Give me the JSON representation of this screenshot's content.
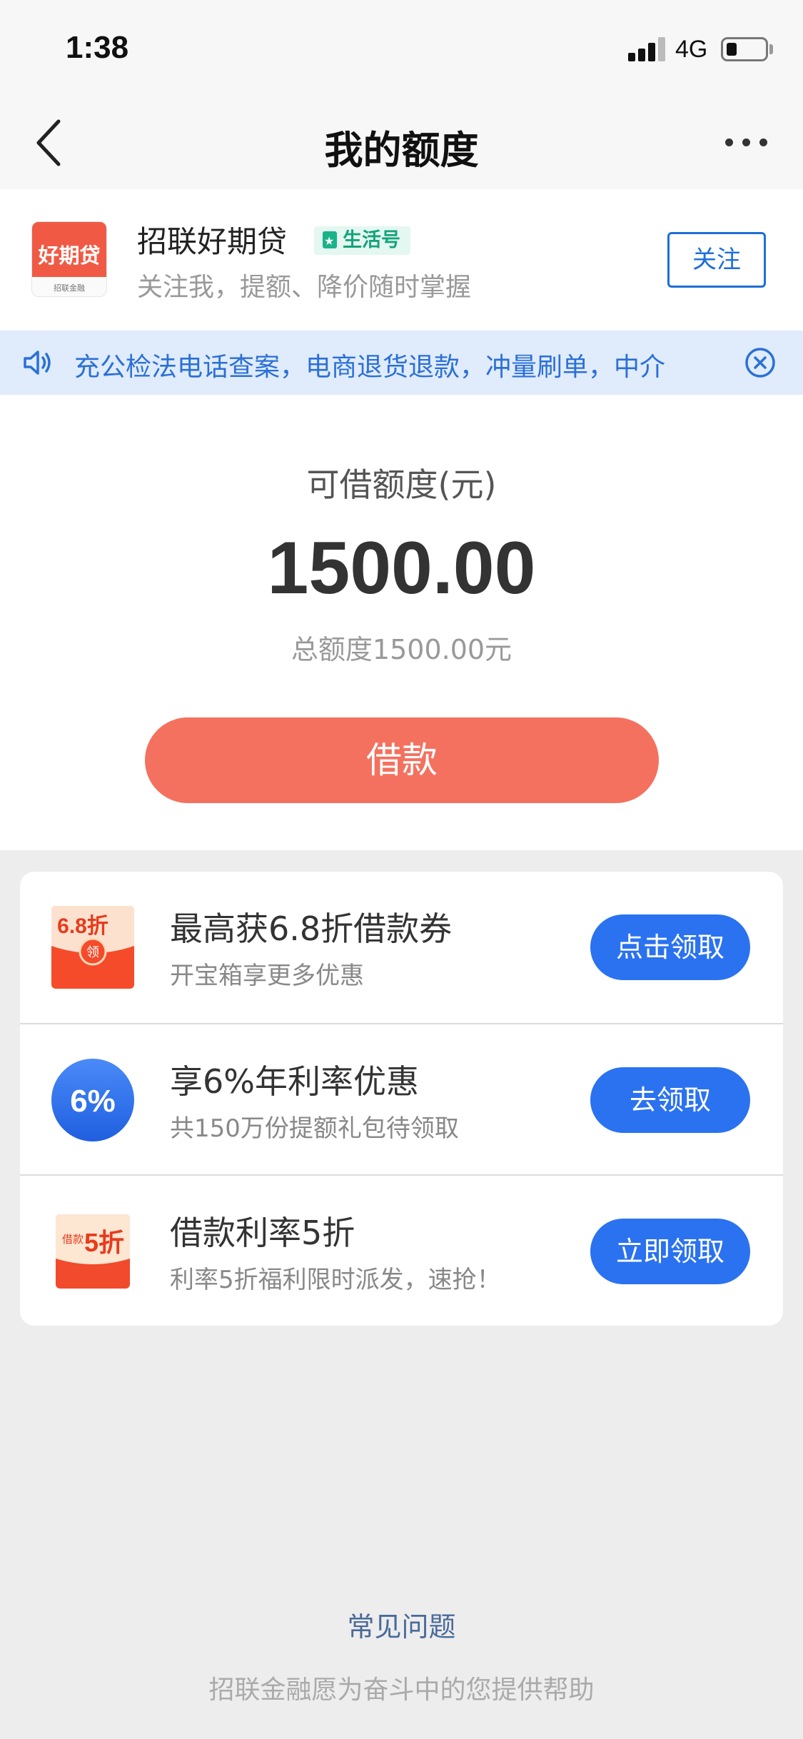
{
  "status_bar": {
    "time": "1:38",
    "network": "4G",
    "battery_percent": 20
  },
  "nav": {
    "title": "我的额度",
    "back_icon": "chevron-left-icon",
    "more_icon": "more-dots-icon"
  },
  "account": {
    "logo_text": "好期贷",
    "logo_subtext": "招联金融",
    "name": "招联好期贷",
    "badge": "生活号",
    "description": "关注我，提额、降价随时掌握",
    "follow_label": "关注"
  },
  "notice": {
    "text": "充公检法电话查案，电商退货退款，冲量刷单，中介"
  },
  "credit": {
    "label": "可借额度(元)",
    "amount": "1500.00",
    "total": "总额度1500.00元",
    "borrow_label": "借款"
  },
  "offers": [
    {
      "icon_top": "6.8折",
      "icon_bottom": "领",
      "title": "最高获6.8折借款券",
      "subtitle": "开宝箱享更多优惠",
      "button": "点击领取"
    },
    {
      "icon_text": "6%",
      "title": "享6%年利率优惠",
      "subtitle": "共150万份提额礼包待领取",
      "button": "去领取"
    },
    {
      "icon_small": "借款",
      "icon_big": "5折",
      "title": "借款利率5折",
      "subtitle": "利率5折福利限时派发，速抢！",
      "button": "立即领取"
    }
  ],
  "footer": {
    "faq": "常见问题",
    "slogan": "招联金融愿为奋斗中的您提供帮助"
  },
  "colors": {
    "accent_blue": "#2a72f0",
    "borrow_red": "#f4715f",
    "notice_bg": "#e0ebfb",
    "badge_green": "#14a37a"
  }
}
